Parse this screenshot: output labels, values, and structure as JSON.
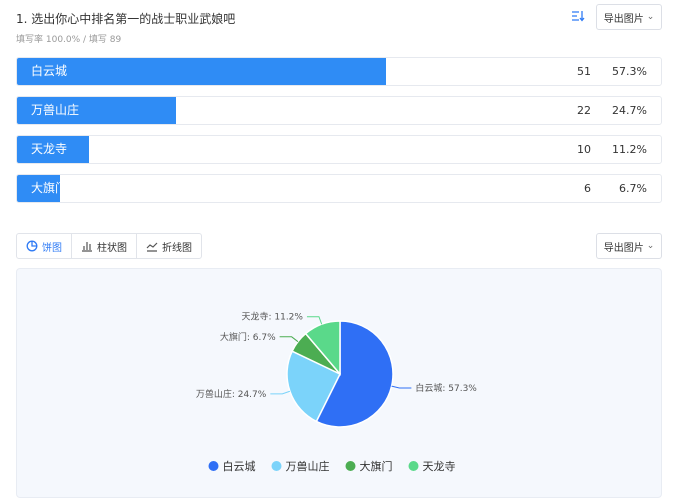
{
  "question": {
    "title": "1. 选出你心中排名第一的战士职业武娘吧",
    "stats": "填写率 100.0% / 填写 89"
  },
  "buttons": {
    "export_label": "导出图片"
  },
  "results": [
    {
      "label": "白云城",
      "count": "51",
      "pct": "57.3%",
      "fraction": 0.573
    },
    {
      "label": "万兽山庄",
      "count": "22",
      "pct": "24.7%",
      "fraction": 0.247
    },
    {
      "label": "天龙寺",
      "count": "10",
      "pct": "11.2%",
      "fraction": 0.112
    },
    {
      "label": "大旗门",
      "count": "6",
      "pct": "6.7%",
      "fraction": 0.067
    }
  ],
  "tabs": [
    {
      "label": "饼图",
      "icon": "pie-icon",
      "active": true
    },
    {
      "label": "柱状图",
      "icon": "bar-chart-icon",
      "active": false
    },
    {
      "label": "折线图",
      "icon": "line-chart-icon",
      "active": false
    }
  ],
  "colors": {
    "accent": "#2f7bf5",
    "bar": "#2f8cf5"
  },
  "chart_data": {
    "type": "pie",
    "title": "",
    "slices": [
      {
        "name": "白云城",
        "value": 57.3,
        "label": "白云城: 57.3%",
        "color": "#2f6ff5"
      },
      {
        "name": "万兽山庄",
        "value": 24.7,
        "label": "万兽山庄: 24.7%",
        "color": "#7bd3fa"
      },
      {
        "name": "大旗门",
        "value": 6.7,
        "label": "大旗门: 6.7%",
        "color": "#4cad52"
      },
      {
        "name": "天龙寺",
        "value": 11.2,
        "label": "天龙寺: 11.2%",
        "color": "#5ad98a"
      }
    ],
    "legend": [
      "白云城",
      "万兽山庄",
      "大旗门",
      "天龙寺"
    ],
    "legend_placement": "bottom"
  }
}
